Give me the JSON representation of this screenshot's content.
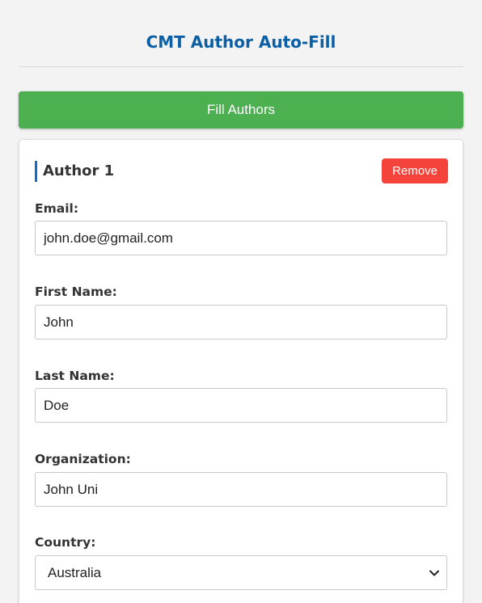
{
  "header": {
    "title": "CMT Author Auto-Fill"
  },
  "actions": {
    "fill_label": "Fill Authors"
  },
  "author": {
    "heading": "Author 1",
    "remove_label": "Remove",
    "fields": {
      "email": {
        "label": "Email:",
        "value": "john.doe@gmail.com"
      },
      "first_name": {
        "label": "First Name:",
        "value": "John"
      },
      "last_name": {
        "label": "Last Name:",
        "value": "Doe"
      },
      "organization": {
        "label": "Organization:",
        "value": "John Uni"
      },
      "country": {
        "label": "Country:",
        "value": "Australia"
      }
    }
  },
  "colors": {
    "title": "#0b5fa5",
    "fill_button": "#4caf50",
    "remove_button": "#f4433a",
    "accent_bar": "#0b6fc7"
  },
  "icons": {
    "country_dropdown": "chevron-down-icon"
  }
}
